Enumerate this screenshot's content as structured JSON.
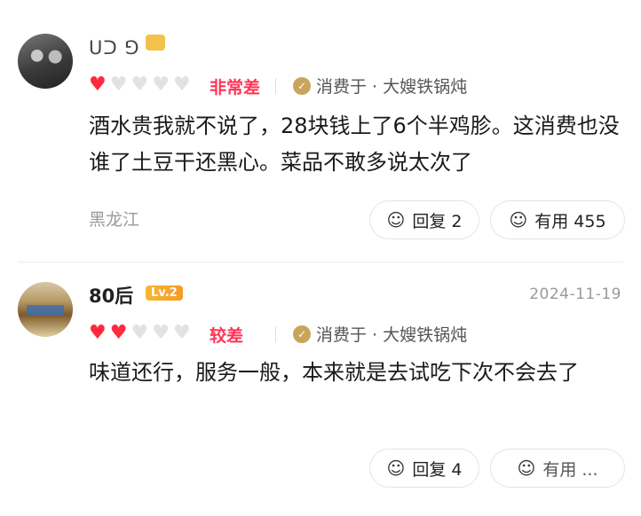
{
  "reviews": [
    {
      "username": "ᑌᑐ ⅁",
      "rating_label": "非常差",
      "hearts_filled": 1,
      "hearts_total": 5,
      "consume_text": "消费于 · 大嫂铁锅炖",
      "content": "酒水贵我就不说了，28块钱上了6个半鸡胗。这消费也没谁了土豆干还黑心。菜品不敢多说太次了",
      "location": "黑龙江",
      "reply_label": "回复 2",
      "useful_label": "有用 455"
    },
    {
      "username": "80后",
      "level_badge": "Lv.2",
      "date": "2024-11-19",
      "rating_label": "较差",
      "hearts_filled": 2,
      "hearts_total": 5,
      "consume_text": "消费于 · 大嫂铁锅炖",
      "content": "味道还行，服务一般，本来就是去试吃下次不会去了",
      "reply_label": "回复 4",
      "useful_label": "有用 ..."
    }
  ],
  "icons": {
    "reply": "comment-bubble-icon",
    "useful": "smile-icon",
    "consume": "coupon-icon",
    "heart": "heart-icon"
  },
  "colors": {
    "heart_on": "#ff2a3e",
    "heart_off": "#e2e2e2",
    "rating_label": "#ff3355",
    "muted": "#9a9a9a"
  }
}
